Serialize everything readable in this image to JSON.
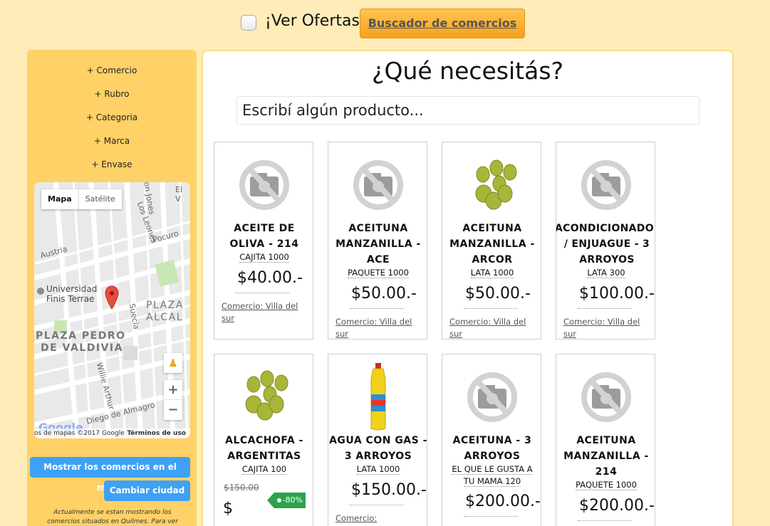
{
  "top": {
    "ofertas_label": "¡Ver Ofertas!",
    "buscador_label": "Buscador de comercios"
  },
  "sidebar": {
    "filters": [
      "+ Comercio",
      "+ Rubro",
      "+ Categoria",
      "+ Marca",
      "+ Envase"
    ],
    "map": {
      "type_map": "Mapa",
      "type_satellite": "Satélite",
      "streets": [
        "Austria",
        "Los Leones",
        "Pocuro",
        "Suecia",
        "Willie Arthur",
        "Diego de Almagro",
        "on Jones",
        "El V"
      ],
      "places": [
        "Universidad",
        "Finis Terrae",
        "PLAZA",
        "ALCAL",
        "PLAZA PEDRO",
        "DE VALDIVIA"
      ],
      "logo": "Google",
      "credit": "os de mapas ©2017 Google",
      "terms": "Términos de uso",
      "zoom_in": "+",
      "zoom_out": "−"
    },
    "show_map_button": "Mostrar los comercios en el mapa",
    "change_city_button": "Cambiar ciudad",
    "note": "Actualmente se estan mostrando los comercios situados en Quilmes. Para ver otras ubicaciones,"
  },
  "main": {
    "title": "¿Qué necesitás?",
    "search_placeholder": "Escribí algún producto...",
    "products": [
      {
        "name": "ACEITE DE OLIVA - 214",
        "presentation": "CAJITA 1000",
        "price": "$40.00.-",
        "store": "Comercio: Villa del sur",
        "image": "no-photo"
      },
      {
        "name": "ACEITUNA MANZANILLA - ACE",
        "presentation": "PAQUETE 1000",
        "price": "$50.00.-",
        "store": "Comercio: Villa del sur",
        "image": "no-photo"
      },
      {
        "name": "ACEITUNA MANZANILLA - ARCOR",
        "presentation": "LATA 1000",
        "price": "$50.00.-",
        "store": "Comercio: Villa del sur",
        "image": "olives"
      },
      {
        "name": "ACONDICIONADOR / ENJUAGUE - 3 ARROYOS",
        "presentation": "LATA 300",
        "price": "$100.00.-",
        "store": "Comercio: Villa del sur",
        "image": "no-photo"
      },
      {
        "name": "ALCACHOFA - ARGENTITAS",
        "presentation": "CAJITA 100",
        "old_price": "$150.00",
        "price": "$",
        "discount": "-80%",
        "image": "olives"
      },
      {
        "name": "AGUA CON GAS - 3 ARROYOS",
        "presentation": "LATA 1000",
        "price": "$150.00.-",
        "store": "Comercio:",
        "image": "bottle"
      },
      {
        "name": "ACEITUNA - 3 ARROYOS",
        "presentation": "EL QUE LE GUSTA A TU MAMA 120",
        "price": "$200.00.-",
        "image": "no-photo"
      },
      {
        "name": "ACEITUNA MANZANILLA - 214",
        "presentation": "PAQUETE 1000",
        "price": "$200.00.-",
        "image": "no-photo"
      }
    ]
  }
}
